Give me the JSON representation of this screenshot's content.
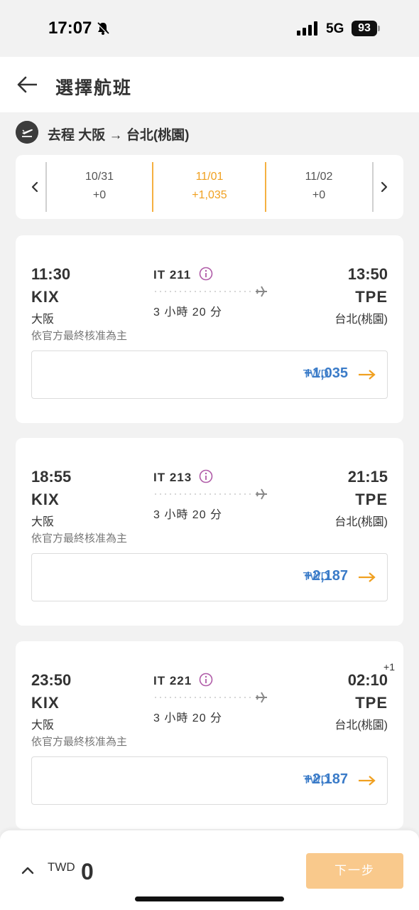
{
  "status_bar": {
    "time": "17:07",
    "network": "5G",
    "battery": "93"
  },
  "header": {
    "title": "選擇航班"
  },
  "route": {
    "label": "去程  大阪 → 台北(桃園)"
  },
  "dates": [
    {
      "date": "10/31",
      "price": "+0",
      "active": false
    },
    {
      "date": "11/01",
      "price": "+1,035",
      "active": true
    },
    {
      "date": "11/02",
      "price": "+0",
      "active": false
    }
  ],
  "flights": [
    {
      "dep_time": "11:30",
      "dep_code": "KIX",
      "dep_city": "大阪",
      "arr_time": "13:50",
      "arr_code": "TPE",
      "arr_city": "台北(桃園)",
      "day_offset": "",
      "flight_no": "IT 211",
      "duration": "3 小時 20 分",
      "note": "依官方最終核准為主",
      "currency": "TWD",
      "price": "+1,035"
    },
    {
      "dep_time": "18:55",
      "dep_code": "KIX",
      "dep_city": "大阪",
      "arr_time": "21:15",
      "arr_code": "TPE",
      "arr_city": "台北(桃園)",
      "day_offset": "",
      "flight_no": "IT 213",
      "duration": "3 小時 20 分",
      "note": "依官方最終核准為主",
      "currency": "TWD",
      "price": "+2,187"
    },
    {
      "dep_time": "23:50",
      "dep_code": "KIX",
      "dep_city": "大阪",
      "arr_time": "02:10",
      "arr_code": "TPE",
      "arr_city": "台北(桃園)",
      "day_offset": "+1",
      "flight_no": "IT 221",
      "duration": "3 小時 20 分",
      "note": "依官方最終核准為主",
      "currency": "TWD",
      "price": "+2,187"
    }
  ],
  "bottom": {
    "currency": "TWD",
    "total": "0",
    "next_label": "下一步"
  },
  "colors": {
    "accent_orange": "#f0a020",
    "price_blue": "#3a7bc8",
    "info_purple": "#b05ca8",
    "button_disabled": "#f9c98c"
  },
  "icons": {
    "back": "arrow-left-icon",
    "route": "plane-departure-icon",
    "info": "info-icon",
    "flight": "airplane-icon",
    "fare": "arrow-right-icon",
    "expand": "chevron-up-icon",
    "prev_date": "chevron-left-icon",
    "next_date": "chevron-right-icon"
  }
}
